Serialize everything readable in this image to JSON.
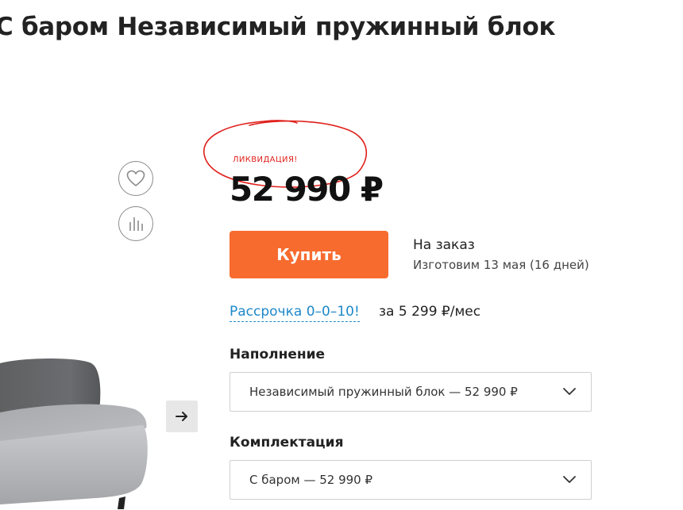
{
  "product": {
    "title": "С баром Независимый пружинный блок"
  },
  "badge": {
    "sale_label": "ЛИКВИДАЦИЯ!"
  },
  "price": {
    "value": "52 990 ₽"
  },
  "buy": {
    "label": "Купить"
  },
  "availability": {
    "status": "На заказ",
    "production": "Изготовим 13 мая (16 дней)"
  },
  "installment": {
    "link_label": "Рассрочка 0–0–10!",
    "amount": "за 5 299 ₽/мес"
  },
  "options": {
    "filling": {
      "label": "Наполнение",
      "value": "Независимый пружинный блок — 52 990 ₽"
    },
    "kit": {
      "label": "Комплектация",
      "value": "С баром — 52 990 ₽"
    }
  },
  "icons": {
    "favorite": "heart-icon",
    "compare": "compare-bars-icon",
    "gallery_next": "arrow-right-icon",
    "dropdown": "chevron-down-icon"
  },
  "colors": {
    "accent": "#f76b2f",
    "link": "#1d88c9",
    "sale": "#e0201b"
  }
}
